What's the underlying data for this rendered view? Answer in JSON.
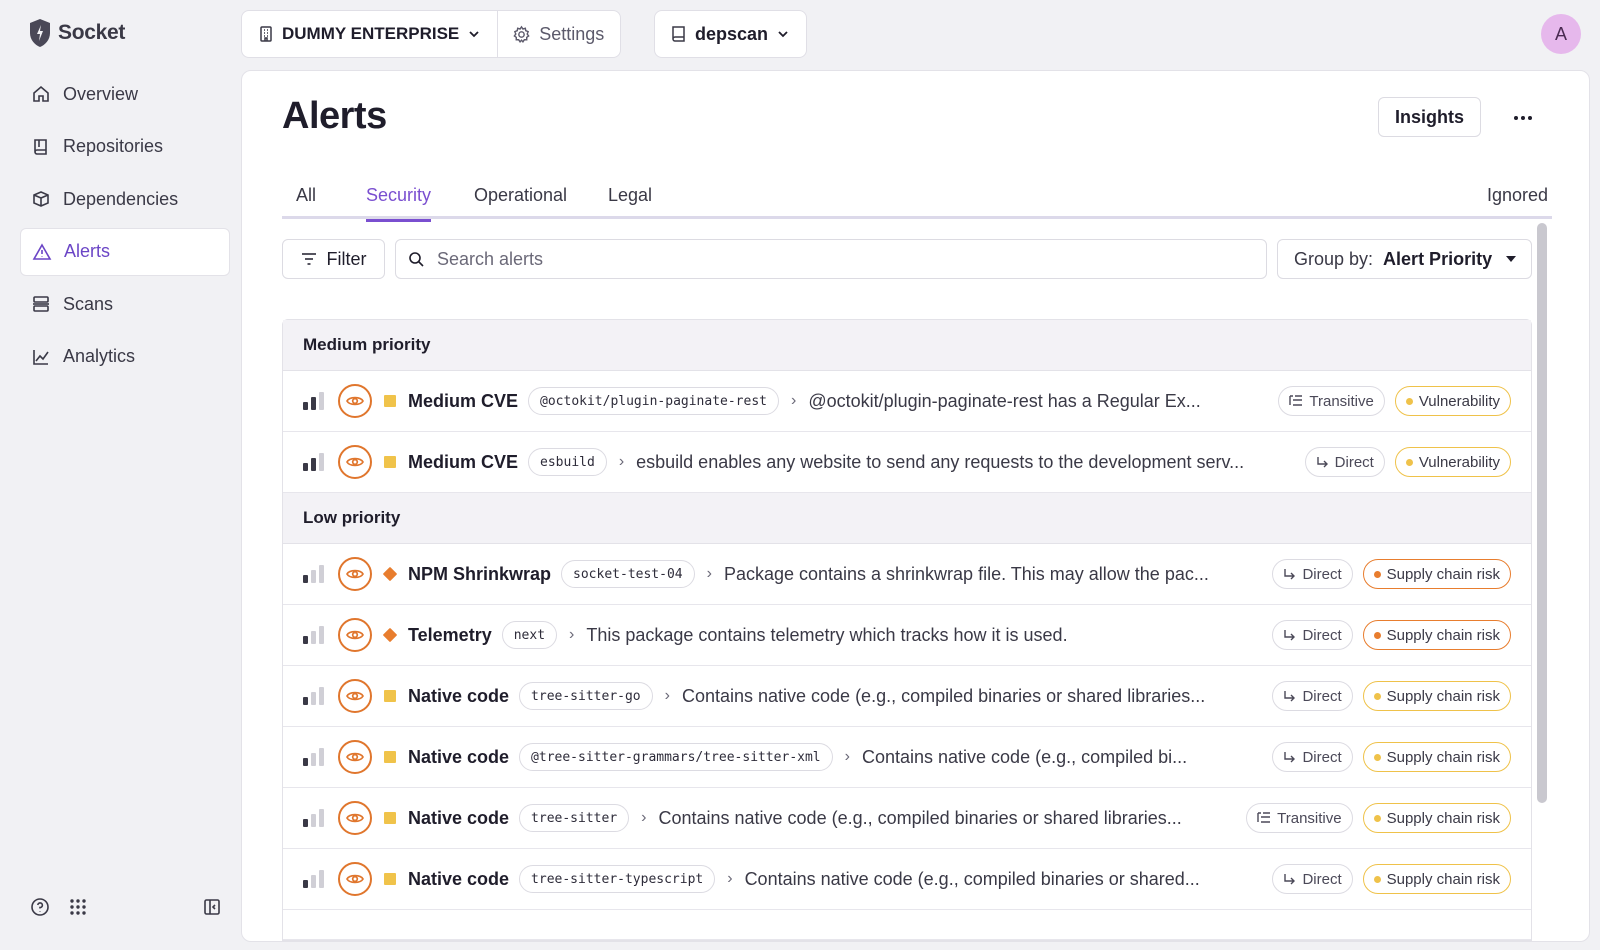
{
  "app": {
    "name": "Socket"
  },
  "nav": {
    "items": [
      {
        "label": "Overview",
        "icon": "home-icon"
      },
      {
        "label": "Repositories",
        "icon": "book-icon"
      },
      {
        "label": "Dependencies",
        "icon": "package-icon"
      },
      {
        "label": "Alerts",
        "icon": "warning-icon",
        "active": true
      },
      {
        "label": "Scans",
        "icon": "scan-icon"
      },
      {
        "label": "Analytics",
        "icon": "chart-icon"
      }
    ]
  },
  "topbar": {
    "org": "DUMMY ENTERPRISE",
    "settings": "Settings",
    "repo": "depscan",
    "avatar_initial": "A"
  },
  "page": {
    "title": "Alerts",
    "insights": "Insights"
  },
  "tabs": {
    "all": "All",
    "security": "Security",
    "operational": "Operational",
    "legal": "Legal",
    "ignored": "Ignored",
    "active": "Security"
  },
  "toolbar": {
    "filter": "Filter",
    "search_placeholder": "Search alerts",
    "groupby_label": "Group by:",
    "groupby_value": "Alert Priority"
  },
  "groups": [
    {
      "name": "Medium priority",
      "rows": [
        {
          "level": 2,
          "severity": "square",
          "title": "Medium CVE",
          "package": "@octokit/plugin-paginate-rest",
          "description": "@octokit/plugin-paginate-rest has a Regular Ex...",
          "dependency": "Transitive",
          "type": "Vulnerability",
          "type_color": "#efc24a"
        },
        {
          "level": 2,
          "severity": "square",
          "title": "Medium CVE",
          "package": "esbuild",
          "description": "esbuild enables any website to send any requests to the development serv...",
          "dependency": "Direct",
          "type": "Vulnerability",
          "type_color": "#efc24a"
        }
      ]
    },
    {
      "name": "Low priority",
      "rows": [
        {
          "level": 1,
          "severity": "diamond",
          "title": "NPM Shrinkwrap",
          "package": "socket-test-04",
          "description": "Package contains a shrinkwrap file. This may allow the pac...",
          "dependency": "Direct",
          "type": "Supply chain risk",
          "type_color": "#e87d2e"
        },
        {
          "level": 1,
          "severity": "diamond",
          "title": "Telemetry",
          "package": "next",
          "description": "This package contains telemetry which tracks how it is used.",
          "dependency": "Direct",
          "type": "Supply chain risk",
          "type_color": "#e87d2e"
        },
        {
          "level": 1,
          "severity": "square",
          "title": "Native code",
          "package": "tree-sitter-go",
          "description": "Contains native code (e.g., compiled binaries or shared libraries...",
          "dependency": "Direct",
          "type": "Supply chain risk",
          "type_color": "#efc24a"
        },
        {
          "level": 1,
          "severity": "square",
          "title": "Native code",
          "package": "@tree-sitter-grammars/tree-sitter-xml",
          "description": "Contains native code (e.g., compiled bi...",
          "dependency": "Direct",
          "type": "Supply chain risk",
          "type_color": "#efc24a"
        },
        {
          "level": 1,
          "severity": "square",
          "title": "Native code",
          "package": "tree-sitter",
          "description": "Contains native code (e.g., compiled binaries or shared libraries...",
          "dependency": "Transitive",
          "type": "Supply chain risk",
          "type_color": "#efc24a"
        },
        {
          "level": 1,
          "severity": "square",
          "title": "Native code",
          "package": "tree-sitter-typescript",
          "description": "Contains native code (e.g., compiled binaries or shared...",
          "dependency": "Direct",
          "type": "Supply chain risk",
          "type_color": "#efc24a"
        }
      ]
    }
  ],
  "colors": {
    "accent": "#7a4fd0",
    "eye": "#e0762d",
    "medium": "#efc24a",
    "low": "#e87d2e"
  }
}
